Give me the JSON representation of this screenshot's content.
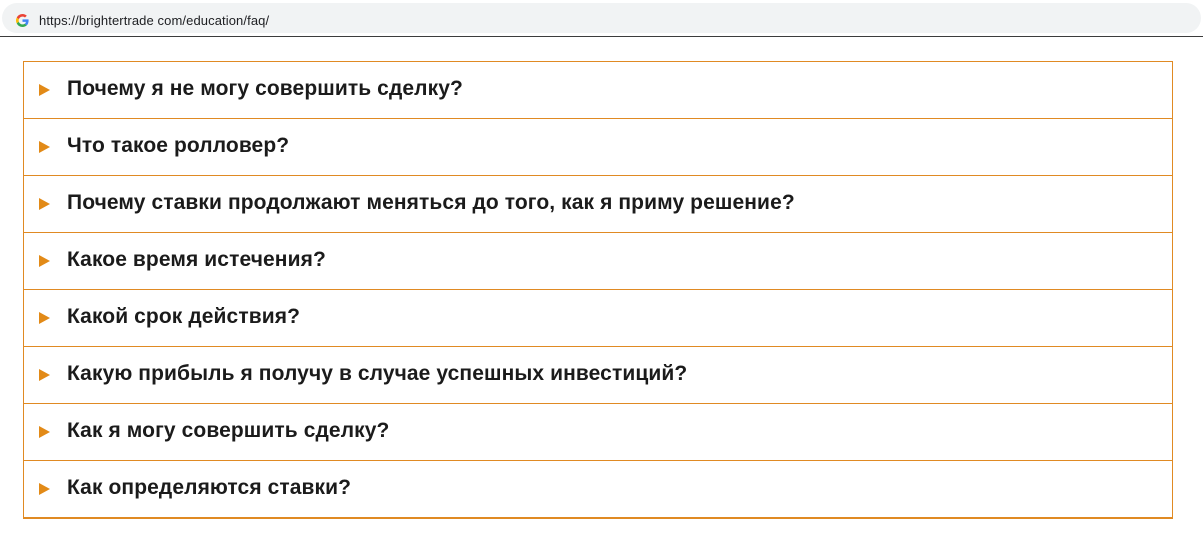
{
  "browser": {
    "url": "https://brightertrade com/education/faq/",
    "favicon_icon": "google-g-icon"
  },
  "colors": {
    "accent": "#e08a23",
    "text": "#1b1b1b"
  },
  "faq": {
    "arrow_icon": "triangle-right-icon",
    "items": [
      {
        "question": "Почему я не могу совершить сделку?"
      },
      {
        "question": "Что такое ролловер?"
      },
      {
        "question": "Почему ставки продолжают меняться до того, как я приму решение?"
      },
      {
        "question": "Какое время истечения?"
      },
      {
        "question": "Какой срок действия?"
      },
      {
        "question": "Какую прибыль я получу в случае успешных инвестиций?"
      },
      {
        "question": "Как я могу совершить сделку?"
      },
      {
        "question": "Как определяются ставки?"
      }
    ]
  }
}
